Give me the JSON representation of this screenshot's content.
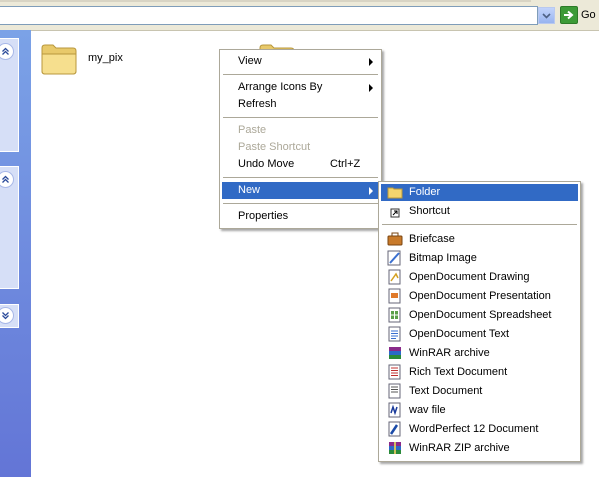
{
  "toolbar": {
    "go_label": "Go"
  },
  "files": [
    {
      "label": "my_pix"
    }
  ],
  "context_menu": {
    "items": [
      {
        "label": "View",
        "submenu": true
      },
      {
        "label": "Arrange Icons By",
        "submenu": true
      },
      {
        "label": "Refresh"
      },
      {
        "label": "Paste",
        "disabled": true
      },
      {
        "label": "Paste Shortcut",
        "disabled": true
      },
      {
        "label": "Undo Move",
        "shortcut": "Ctrl+Z"
      },
      {
        "label": "New",
        "submenu": true,
        "highlighted": true
      },
      {
        "label": "Properties"
      }
    ]
  },
  "new_submenu": {
    "items": [
      {
        "label": "Folder",
        "icon": "folder-icon",
        "highlighted": true
      },
      {
        "label": "Shortcut",
        "icon": "shortcut-icon"
      },
      {
        "label": "Briefcase",
        "icon": "briefcase-icon"
      },
      {
        "label": "Bitmap Image",
        "icon": "bitmap-icon"
      },
      {
        "label": "OpenDocument Drawing",
        "icon": "odg-icon"
      },
      {
        "label": "OpenDocument Presentation",
        "icon": "odp-icon"
      },
      {
        "label": "OpenDocument Spreadsheet",
        "icon": "ods-icon"
      },
      {
        "label": "OpenDocument Text",
        "icon": "odt-icon"
      },
      {
        "label": "WinRAR archive",
        "icon": "winrar-icon"
      },
      {
        "label": "Rich Text Document",
        "icon": "rtf-icon"
      },
      {
        "label": "Text Document",
        "icon": "text-document-icon"
      },
      {
        "label": "wav file",
        "icon": "wav-icon"
      },
      {
        "label": "WordPerfect 12 Document",
        "icon": "wordperfect-icon"
      },
      {
        "label": "WinRAR ZIP archive",
        "icon": "winrar-zip-icon"
      }
    ]
  },
  "colors": {
    "highlight": "#316ac5",
    "task_pane": "#6d8ddf",
    "disabled_text": "#aca899"
  }
}
